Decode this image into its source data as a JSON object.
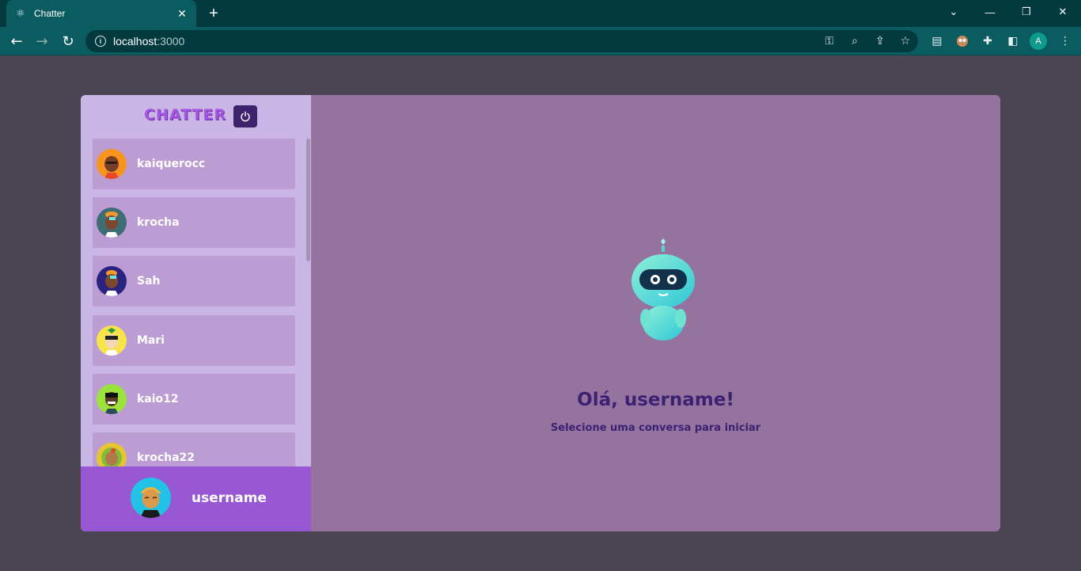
{
  "browser": {
    "tab_title": "Chatter",
    "url_host": "localhost",
    "url_port": ":3000",
    "profile_initial": "A"
  },
  "app": {
    "brand": "CHATTER",
    "contacts": [
      {
        "name": "kaiquerocc",
        "avatar_color": "#f7941d"
      },
      {
        "name": "krocha",
        "avatar_color": "#3f6d76"
      },
      {
        "name": "Sah",
        "avatar_color": "#2b2380"
      },
      {
        "name": "Mari",
        "avatar_color": "#f8e34a"
      },
      {
        "name": "kaio12",
        "avatar_color": "#9be23a"
      },
      {
        "name": "krocha22",
        "avatar_color": "#e7c531"
      }
    ],
    "current_user": {
      "name": "username",
      "avatar_color": "#22c2e6"
    },
    "greeting": "Olá, username!",
    "subtitle": "Selecione uma conversa para iniciar"
  },
  "colors": {
    "page_bg": "#4b4453",
    "sidebar_bg": "#c9b6e4",
    "item_bg": "#bc9dd3",
    "main_bg": "#96729f",
    "footer_bg": "#9857d3",
    "accent_dark": "#3b2172"
  },
  "icons": [
    "react-icon",
    "close-icon",
    "plus-icon",
    "back-arrow-icon",
    "forward-arrow-icon",
    "reload-icon",
    "info-icon",
    "key-icon",
    "zoom-icon",
    "share-icon",
    "star-icon",
    "extensions-icon",
    "sidepanel-icon",
    "power-icon"
  ]
}
